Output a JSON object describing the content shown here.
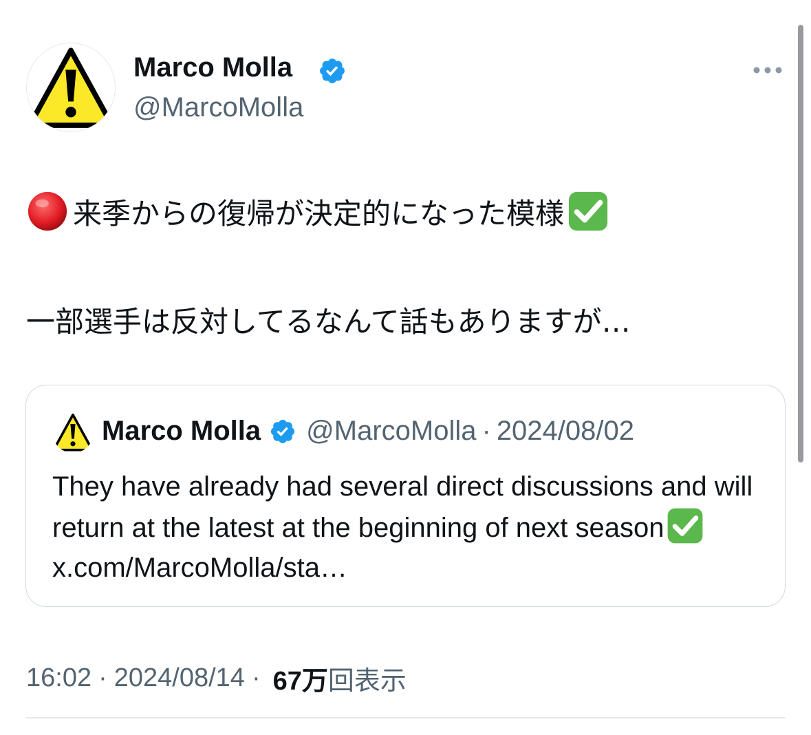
{
  "author": {
    "name": "Marco Molla",
    "handle": "@MarcoMolla",
    "avatar_icon": "warning-sign-icon",
    "verified_icon": "verified-badge-icon"
  },
  "tweet": {
    "line1_text": "来季からの復帰が決定的になった模様",
    "line2_text": "一部選手は反対してるなんて話もありますが…",
    "line1_leading_icon": "red-circle-emoji-icon",
    "line1_trailing_icon": "check-mark-emoji-icon"
  },
  "quoted": {
    "name": "Marco Molla",
    "handle": "@MarcoMolla",
    "separator": "·",
    "date": "2024/08/02",
    "text_before_icon": "They have already had several direct discussions and will return at the latest at the beginning of next season",
    "text_after_icon": " x.com/MarcoMolla/sta…"
  },
  "meta": {
    "time": "16:02",
    "separator": "·",
    "date": "2024/08/14",
    "view_count": "67万",
    "view_label": "回表示"
  },
  "colors": {
    "verified_blue": "#1d9bf0",
    "secondary_text": "#536471",
    "border": "#cfd9de",
    "check_green": "#5bb84c"
  }
}
